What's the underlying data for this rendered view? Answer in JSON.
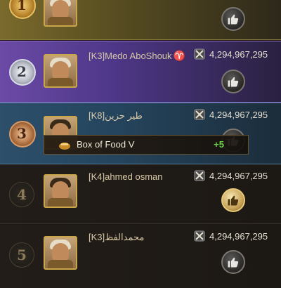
{
  "leaderboard": {
    "rows": [
      {
        "rank": "1",
        "name": "",
        "power": "",
        "liked": false
      },
      {
        "rank": "2",
        "name": "[K3]Medo AboShouk",
        "name_glyph": "♈",
        "power": "4,294,967,295",
        "liked": false
      },
      {
        "rank": "3",
        "name": "[K8]طير حزين",
        "power": "4,294,967,295",
        "liked": false
      },
      {
        "rank": "4",
        "name": "[K4]ahmed osman",
        "power": "4,294,967,295",
        "liked": true
      },
      {
        "rank": "5",
        "name": "[K3]محمدالفظ",
        "power": "4,294,967,295",
        "liked": false
      }
    ]
  },
  "tooltip": {
    "item": "Box of Food V",
    "amount": "+5"
  },
  "icons": {
    "power": "crossed-swords-icon",
    "like": "thumbs-up-icon",
    "food": "food-box-icon"
  },
  "colors": {
    "rank2_bg": "#4e3788",
    "rank3_bg": "#25455e",
    "rank1_bg": "#5c5122",
    "reward_green": "#6fd04e"
  }
}
